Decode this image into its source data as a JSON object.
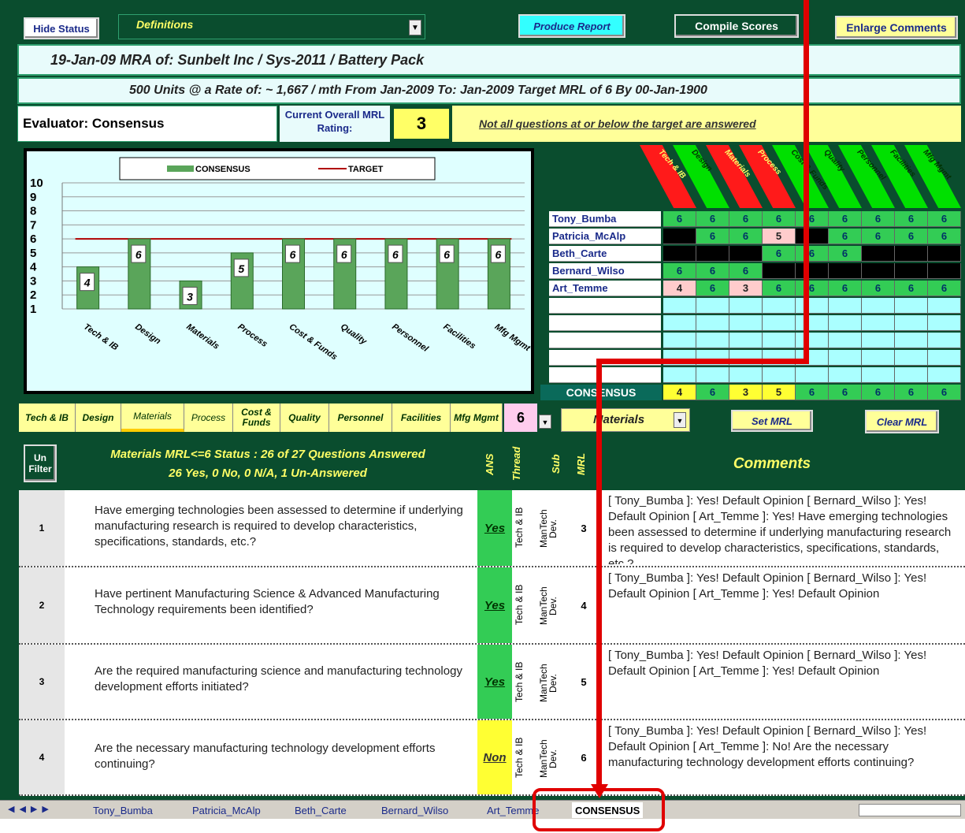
{
  "toolbar": {
    "hide_status": "Hide Status",
    "definitions": "Definitions",
    "produce_report": "Produce Report",
    "compile_scores": "Compile Scores",
    "enlarge_comments": "Enlarge Comments"
  },
  "header": {
    "line1": "19-Jan-09   MRA of:  Sunbelt Inc / Sys-2011 /  Battery Pack",
    "line2": "500 Units   @ a Rate of:  ~ 1,667 / mth  From Jan-2009  To:  Jan-2009  Target MRL of  6   By 00-Jan-1900",
    "evaluator": "Evaluator: Consensus",
    "current_overall_label": "Current Overall MRL Rating:",
    "current_overall_value": "3",
    "warning": "Not all questions at or below the target are answered"
  },
  "chart_data": {
    "type": "bar",
    "categories": [
      "Tech & IB",
      "Design",
      "Materials",
      "Process",
      "Cost & Funds",
      "Quality",
      "Personnel",
      "Facilities",
      "Mfg Mgmt"
    ],
    "series": [
      {
        "name": "CONSENSUS",
        "values": [
          4,
          6,
          3,
          5,
          6,
          6,
          6,
          6,
          6
        ]
      },
      {
        "name": "TARGET",
        "values": [
          6,
          6,
          6,
          6,
          6,
          6,
          6,
          6,
          6
        ]
      }
    ],
    "ylim": [
      1,
      10
    ],
    "yticks": [
      "10",
      "9",
      "8",
      "7",
      "6",
      "5",
      "4",
      "3",
      "2",
      "1"
    ],
    "legend": "top",
    "colors": {
      "bar": "#5aa55a",
      "target": "#b00000"
    }
  },
  "grid": {
    "categories": [
      {
        "label": "Tech & IB",
        "color": "#ff1a1a"
      },
      {
        "label": "Design",
        "color": "#00e000"
      },
      {
        "label": "Materials",
        "color": "#ff1a1a"
      },
      {
        "label": "Process",
        "color": "#ff1a1a"
      },
      {
        "label": "Cost & Funds",
        "color": "#00e000"
      },
      {
        "label": "Quality",
        "color": "#00e000"
      },
      {
        "label": "Personnel",
        "color": "#00e000"
      },
      {
        "label": "Facilities",
        "color": "#00e000"
      },
      {
        "label": "Mfg Mgmt",
        "color": "#00e000"
      }
    ],
    "evaluators": [
      {
        "name": "Tony_Bumba",
        "scores": [
          "6",
          "6",
          "6",
          "6",
          "6",
          "6",
          "6",
          "6",
          "6"
        ]
      },
      {
        "name": "Patricia_McAlp",
        "scores": [
          "",
          "6",
          "6",
          "5",
          "",
          "6",
          "6",
          "6",
          "6"
        ]
      },
      {
        "name": "Beth_Carte",
        "scores": [
          "",
          "",
          "",
          "6",
          "6",
          "6",
          "",
          "",
          ""
        ]
      },
      {
        "name": "Bernard_Wilso",
        "scores": [
          "6",
          "6",
          "6",
          "",
          "",
          "",
          "",
          "",
          ""
        ]
      },
      {
        "name": "Art_Temme",
        "scores": [
          "4",
          "6",
          "3",
          "6",
          "6",
          "6",
          "6",
          "6",
          "6"
        ]
      }
    ],
    "consensus_label": "CONSENSUS",
    "consensus": [
      "4",
      "6",
      "3",
      "5",
      "6",
      "6",
      "6",
      "6",
      "6"
    ]
  },
  "category_tabs": [
    "Tech & IB",
    "Design",
    "Materials",
    "Process",
    "Cost & Funds",
    "Quality",
    "Personnel",
    "Facilities",
    "Mfg Mgmt"
  ],
  "mrl_select": {
    "value": "6",
    "category": "Materials",
    "set_mrl": "Set MRL",
    "clear_mrl": "Clear MRL"
  },
  "status_header": {
    "unfilter": "Un Filter",
    "line1": "Materials  MRL<=6 Status :  26 of 27 Questions Answered",
    "line2": "26 Yes,   0 No,   0 N/A,   1 Un-Answered",
    "col_ans": "ANS",
    "col_thread": "Thread",
    "col_sub": "Sub",
    "col_mrl": "MRL",
    "col_comments": "Comments"
  },
  "questions": [
    {
      "num": "1",
      "text": "Have emerging technologies been assessed to determine if underlying manufacturing research is required to develop characteristics, specifications, standards, etc.?",
      "ans": "Yes",
      "thread": "Tech & IB",
      "sub": "ManTech Dev.",
      "mrl": "3",
      "comment": "[ Tony_Bumba ]: Yes!  Default Opinion     [ Bernard_Wilso ]: Yes!  Default Opinion     [ Art_Temme ]: Yes!  Have emerging technologies been assessed to determine if underlying manufacturing research is required to develop characteristics, specifications, standards, etc.?"
    },
    {
      "num": "2",
      "text": "Have pertinent Manufacturing Science & Advanced Manufacturing Technology requirements been identified?",
      "ans": "Yes",
      "thread": "Tech & IB",
      "sub": "ManTech Dev.",
      "mrl": "4",
      "comment": "[ Tony_Bumba ]: Yes!  Default Opinion     [ Bernard_Wilso ]: Yes!  Default Opinion     [ Art_Temme ]: Yes!  Default Opinion"
    },
    {
      "num": "3",
      "text": "Are the required manufacturing science and manufacturing technology development efforts initiated?",
      "ans": "Yes",
      "thread": "Tech & IB",
      "sub": "ManTech Dev.",
      "mrl": "5",
      "comment": "[ Tony_Bumba ]: Yes!  Default Opinion     [ Bernard_Wilso ]: Yes!  Default Opinion     [ Art_Temme ]: Yes!  Default Opinion"
    },
    {
      "num": "4",
      "text": "Are the necessary manufacturing technology development efforts continuing?",
      "ans": "Non",
      "thread": "Tech & IB",
      "sub": "ManTech Dev.",
      "mrl": "6",
      "comment": "[ Tony_Bumba ]: Yes!  Default Opinion     [ Bernard_Wilso ]: Yes!  Default Opinion     [ Art_Temme ]: No!  Are the necessary manufacturing technology development efforts continuing?"
    }
  ],
  "sheet_tabs": [
    "Tony_Bumba",
    "Patricia_McAlp",
    "Beth_Carte",
    "Bernard_Wilso",
    "Art_Temme",
    "CONSENSUS"
  ],
  "colors": {
    "dark_green": "#0a4d2e",
    "yes_green": "#33cc55",
    "non_yellow": "#ffff33",
    "annotation_red": "#e00000"
  }
}
